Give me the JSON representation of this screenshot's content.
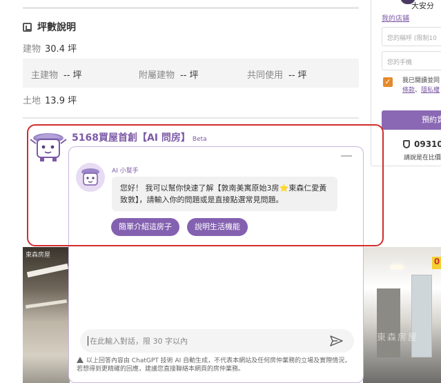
{
  "listing": {
    "section_title": "坪數說明",
    "building": {
      "label": "建物",
      "value": "30.4 坪"
    },
    "sub_items": [
      {
        "label": "主建物",
        "value": "-- 坪"
      },
      {
        "label": "附屬建物",
        "value": "-- 坪"
      },
      {
        "label": "共同使用",
        "value": "-- 坪"
      }
    ],
    "land": {
      "label": "土地",
      "value": "13.9 坪"
    }
  },
  "sidebar": {
    "agent_name": "大安分",
    "store_link": "我的店鋪",
    "name_placeholder": "您的稱呼 (限制10",
    "phone_placeholder": "您的手機",
    "check_mark": "✓",
    "agree_line1": "我已閱讀並同",
    "agree_link1": "條款",
    "agree_sep": "、",
    "agree_link2": "隱私權",
    "book_button": "預約賞",
    "phone": "09310",
    "phone_note": "請說是在比價"
  },
  "photos": {
    "left_watermark": "東森房屋",
    "right_watermark": "東森房屋",
    "right_badge": "0"
  },
  "ai_chat": {
    "title": "5168買屋首創【AI 問房】",
    "beta": "Beta",
    "bot_name": "AI 小幫手",
    "message_part1": "您好！ 我可以幫你快速了解【敦南美寓原始3房",
    "message_star": "⭐",
    "message_part2": "東森仁愛黃致敦】，請輸入你的問題或是直接點選常見問題。",
    "chips": [
      "簡單介紹這房子",
      "說明生活機能"
    ],
    "input_placeholder": "在此輸入對話，限 30 字以內",
    "disclaimer": "以上回答內容由 ChatGPT 技術 AI 自動生成，不代表本網站及任何房仲業務的立場及實際情況，若想得到更精確的回應，建議您直接聯絡本網頁的房仲業務。"
  },
  "colors": {
    "brand_purple": "#7d5aa6",
    "chip_purple": "#8461b0",
    "annotation_red": "#d22b2b",
    "checkbox_orange": "#e58a2c"
  }
}
